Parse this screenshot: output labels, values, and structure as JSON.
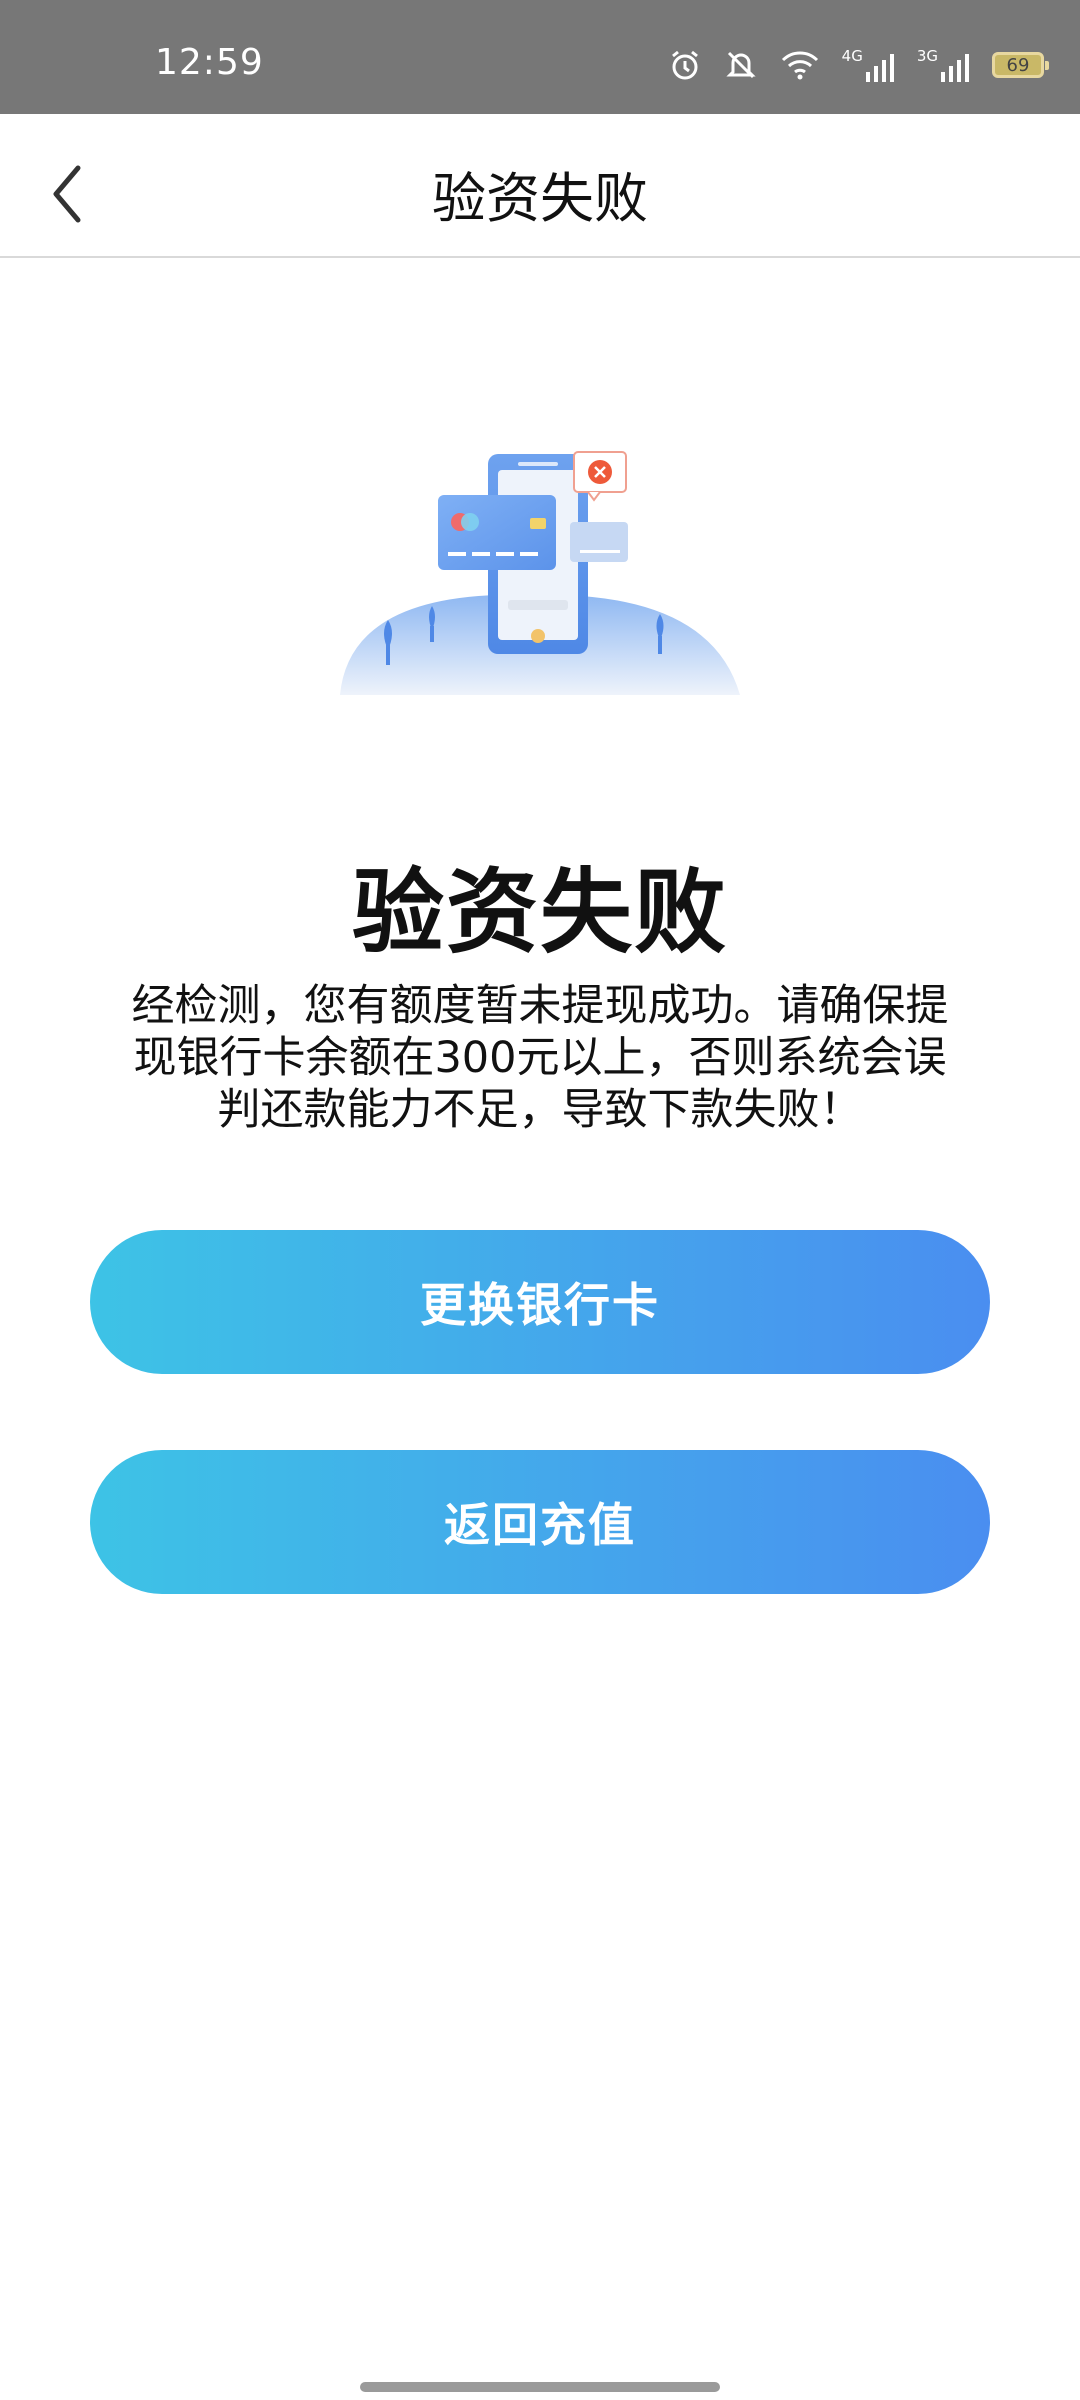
{
  "status_bar": {
    "time": "12:59",
    "battery": "69",
    "network_1": "4G",
    "network_2": "3G",
    "icons": [
      "alarm-icon",
      "bell-off-icon",
      "wifi-icon",
      "signal-4g-icon",
      "signal-3g-icon",
      "battery-icon"
    ]
  },
  "header": {
    "title": "验资失败",
    "back_icon": "chevron-left-icon"
  },
  "result": {
    "title": "验资失败",
    "message": "经检测，您有额度暂未提现成功。请确保提现银行卡余额在300元以上，否则系统会误判还款能力不足，导致下款失败！"
  },
  "buttons": {
    "change_card": "更换银行卡",
    "back_recharge": "返回充值"
  },
  "colors": {
    "button_gradient_start": "#3dc3e6",
    "button_gradient_end": "#4a8ef0",
    "status_bar": "#777777"
  }
}
